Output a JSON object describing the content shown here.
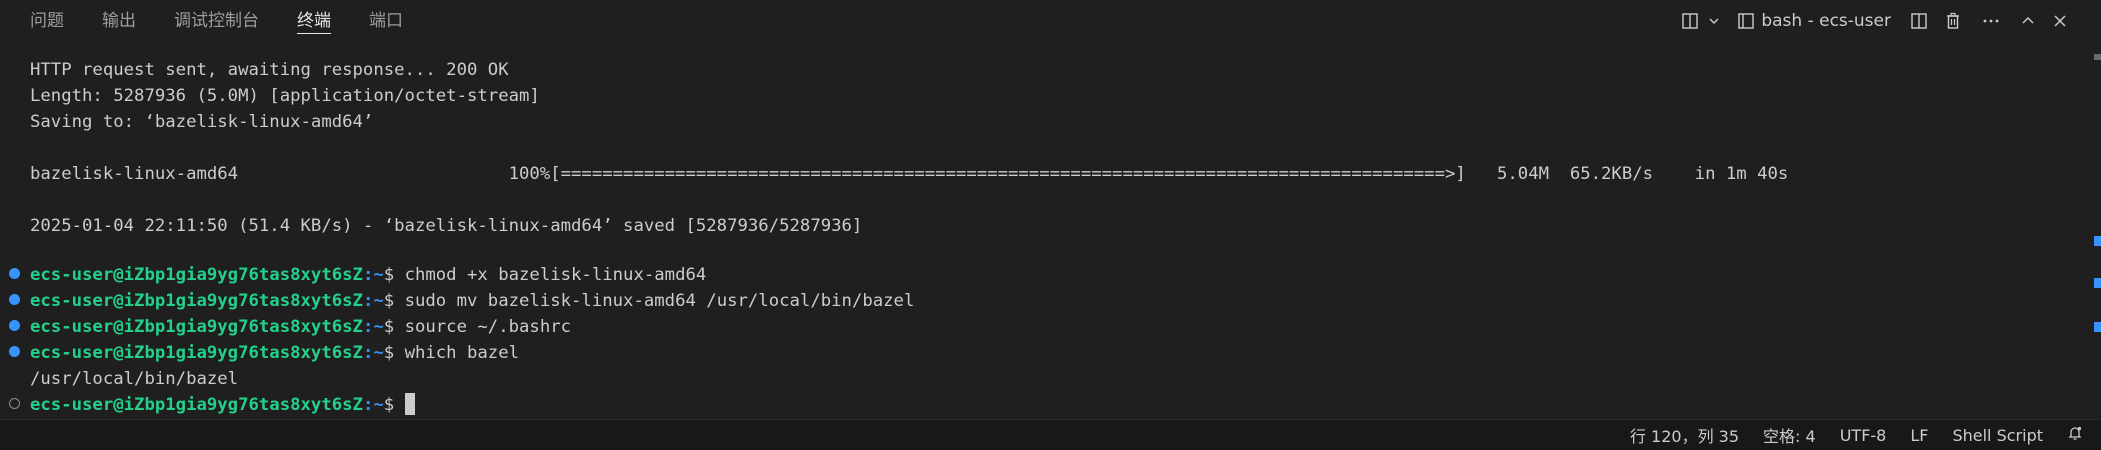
{
  "panel_tabs": [
    "问题",
    "输出",
    "调试控制台",
    "终端",
    "端口"
  ],
  "active_tab": "终端",
  "terminal_name": "bash - ecs-user",
  "icons": {
    "layout": "split-layout-icon",
    "dropdown": "chevron-down-icon",
    "terminal": "terminal-icon",
    "split": "split-terminal-icon",
    "trash": "trash-icon",
    "more": "more-actions-icon",
    "maximize": "chevron-up-icon",
    "close": "close-icon",
    "bell": "bell-icon"
  },
  "terminal": {
    "output_lines": [
      "HTTP request sent, awaiting response... 200 OK",
      "Length: 5287936 (5.0M) [application/octet-stream]",
      "Saving to: ‘bazelisk-linux-amd64’",
      "",
      "bazelisk-linux-amd64                          100%[=====================================================================================>]   5.04M  65.2KB/s    in 1m 40s",
      "",
      "2025-01-04 22:11:50 (51.4 KB/s) - ‘bazelisk-linux-amd64’ saved [5287936/5287936]",
      ""
    ],
    "prompt_user": "ecs-user@iZbp1gia9yg76tas8xyt6sZ",
    "prompt_path": ":~",
    "prompt_symbol": "$ ",
    "commands": [
      "chmod +x bazelisk-linux-amd64",
      "sudo mv bazelisk-linux-amd64 /usr/local/bin/bazel",
      "source ~/.bashrc",
      "which bazel"
    ],
    "command_output": "/usr/local/bin/bazel",
    "current_input": ""
  },
  "status_bar": {
    "position": "行 120，列 35",
    "spaces": "空格: 4",
    "encoding": "UTF-8",
    "eol": "LF",
    "language": "Shell Script"
  },
  "colors": {
    "background": "#1f1f1f",
    "prompt_user": "#23d18b",
    "prompt_path": "#3b8eea",
    "decoration_success": "#3794ff"
  }
}
